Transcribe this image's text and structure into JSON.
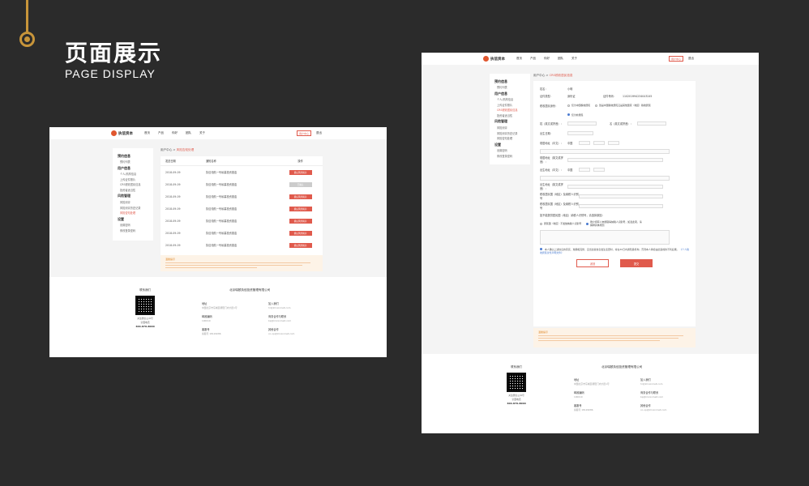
{
  "heading": {
    "cn": "页面展示",
    "en": "PAGE DISPLAY"
  },
  "nav": {
    "logo_text": "执信资本",
    "items": [
      "首页",
      "产品",
      "你好",
      "团队",
      "关于"
    ],
    "user_btn": "用户中心",
    "logout": "退出"
  },
  "sidebar": [
    {
      "group": "预约信息",
      "items": [
        "预约列表"
      ]
    },
    {
      "group": "用户信息",
      "items": [
        "个人/机构信息",
        "上传证件照片",
        "CRS税收居民信息",
        "投资者适当性",
        "风险承受能力"
      ]
    },
    {
      "group": "风险管理",
      "items": [
        "风险测评",
        "风险测评历史记录",
        "风险告知处理"
      ]
    },
    {
      "group": "设置",
      "items": [
        "设置密码",
        "修改登录密码"
      ]
    }
  ],
  "page1": {
    "breadcrumb_root": "用户中心",
    "breadcrumb_current": "风险告知处理",
    "table_headers": [
      "发送日期",
      "通知名称",
      "操作"
    ],
    "rows": [
      {
        "date": "2018-09-09",
        "name": "执信领航一号私募投资基金",
        "action": "确认风险揭示",
        "state": "active"
      },
      {
        "date": "2018-09-09",
        "name": "执信领航一号私募投资基金",
        "action": "已确认",
        "state": "done"
      },
      {
        "date": "2018-09-09",
        "name": "执信领航一号私募投资基金",
        "action": "确认风险揭示",
        "state": "active"
      },
      {
        "date": "2018-09-09",
        "name": "执信领航一号私募投资基金",
        "action": "确认风险揭示",
        "state": "active"
      },
      {
        "date": "2018-09-09",
        "name": "执信领航一号私募投资基金",
        "action": "确认风险揭示",
        "state": "active"
      },
      {
        "date": "2018-09-09",
        "name": "执信领航一号私募投资基金",
        "action": "确认风险揭示",
        "state": "active"
      },
      {
        "date": "2018-09-09",
        "name": "执信领航一号私募投资基金",
        "action": "确认风险揭示",
        "state": "active"
      }
    ],
    "notice_title": "温馨提示"
  },
  "page2": {
    "breadcrumb_root": "用户中心",
    "breadcrumb_current": "CRS税收居民信息",
    "fields": {
      "name_label": "姓名：",
      "name_value": "小明",
      "id_type_label": "证件类型：",
      "id_type_value": "身份证",
      "id_no_label": "证件号码：",
      "id_no_value": "110201994234043245",
      "tax_status_label": "税收居民身份：",
      "opt1": "仅为中国税收居民",
      "opt2": "既是中国税收居民又是其他国家（地区）税收居民",
      "opt3": "仅为非居民",
      "surname_label": "姓（英文或拼音）：",
      "given_label": "名（英文或拼音）：",
      "birth_label": "出生日期：",
      "address_label": "现居地址（中文）：",
      "country": "中国",
      "address_en_label": "现居地址（英文或拼音）：",
      "birthplace_label": "出生地址（中文）：",
      "birthplace_en_label": "出生地址（英文或拼音）：",
      "tax_country_label": "税收居民国（地区）及纳税人识别号",
      "no_tin_label": "如不能提供居民国（地区）纳税人识别号，请选择原因：",
      "reason1": "居民国（地区）不发放纳税人识别号",
      "reason2": "账户持有人未能取得纳税人识别号，如选此项，请解释具体原因",
      "agree_text": "本人确认上述信息的真实、准确和完整，且当这些信息发生变更时，将在30日内通知贵机构，否则本人承担由此造成的不利后果。",
      "agree_link": "《个人税收居民身份声明文件》"
    },
    "back_btn": "返回",
    "submit_btn": "提交",
    "notice_title": "温馨提示"
  },
  "footer": {
    "contact_label": "联系我们",
    "wechat_label": "关注微信公众号",
    "hotline_label": "全国电话",
    "phone": "400-870-8000",
    "company": "北京瑞颐执信投资管理有限公司",
    "cells": [
      {
        "k": "地址",
        "v": "中国北京市东城区朝阳门内大街1号"
      },
      {
        "k": "加入我们",
        "v": "hr@lmxxnmeit.com"
      },
      {
        "k": "邮政编码",
        "v": "100010"
      },
      {
        "k": "商务合作与联系",
        "v": "bp@lmxxnmeit.com"
      },
      {
        "k": "客服号",
        "v": "客服号 18129086"
      },
      {
        "k": "其他合作",
        "v": "co-op@lmxxnmeit.com"
      }
    ]
  },
  "colors": {
    "accent": "#e05a4c",
    "gold": "#c8953a",
    "bg": "#2b2b2b"
  }
}
